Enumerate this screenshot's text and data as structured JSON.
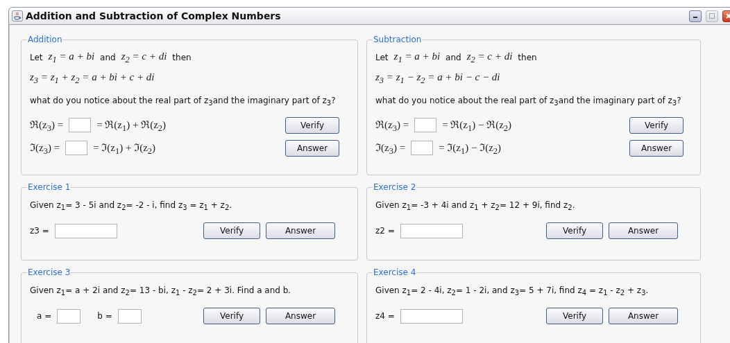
{
  "window": {
    "title": "Addition and Subtraction of Complex Numbers"
  },
  "concepts": [
    {
      "title": "Addition",
      "intro": [
        {
          "kind": "text",
          "text": "Let"
        },
        {
          "kind": "math",
          "text": "z$_{1}$ = a + bi"
        },
        {
          "kind": "text",
          "text": "and"
        },
        {
          "kind": "math",
          "text": "z$_{2}$ = c + di"
        },
        {
          "kind": "text",
          "text": "then"
        }
      ],
      "equation": "z$_{3}$ = z$_{1}$ + z$_{2}$ = a + bi + c + di",
      "question": "what do you notice about the real part of z$_{3}$and the imaginary part of z$_{3}$?",
      "rows": [
        {
          "lhs": "ℜ(z$_{3}$) =",
          "rhs": "= ℜ(z$_{1}$) + ℜ(z$_{2}$)",
          "button": "Verify"
        },
        {
          "lhs": "ℑ(z$_{3}$) =",
          "rhs": "= ℑ(z$_{1}$) + ℑ(z$_{2}$)",
          "button": "Answer"
        }
      ]
    },
    {
      "title": "Subtraction",
      "intro": [
        {
          "kind": "text",
          "text": "Let"
        },
        {
          "kind": "math",
          "text": "z$_{1}$ = a + bi"
        },
        {
          "kind": "text",
          "text": "and"
        },
        {
          "kind": "math",
          "text": "z$_{2}$ = c + di"
        },
        {
          "kind": "text",
          "text": "then"
        }
      ],
      "equation": "z$_{3}$ = z$_{1}$ − z$_{2}$ = a + bi − c − di",
      "question": "what do you notice about the real part of z$_{3}$and the imaginary part of z$_{3}$?",
      "rows": [
        {
          "lhs": "ℜ(z$_{3}$) =",
          "rhs": "= ℜ(z$_{1}$) − ℜ(z$_{2}$)",
          "button": "Verify"
        },
        {
          "lhs": "ℑ(z$_{3}$) =",
          "rhs": "= ℑ(z$_{1}$) − ℑ(z$_{2}$)",
          "button": "Answer"
        }
      ]
    }
  ],
  "exercises": [
    {
      "title": "Exercise 1",
      "prompt": "Given z$_{1}$= 3 - 5i and z$_{2}$= -2 - i, find z$_{3}$ = z$_{1}$ + z$_{2}$.",
      "fields": [
        {
          "label": "z3 =",
          "kind": "wide"
        }
      ],
      "buttons": [
        "Verify",
        "Answer"
      ]
    },
    {
      "title": "Exercise 2",
      "prompt": "Given z$_{1}$= -3 + 4i and z$_{1}$ + z$_{2}$= 12 + 9i, find z$_{2}$.",
      "fields": [
        {
          "label": "z2 =",
          "kind": "wide"
        }
      ],
      "buttons": [
        "Verify",
        "Answer"
      ]
    },
    {
      "title": "Exercise 3",
      "prompt": "Given z$_{1}$= a + 2i and z$_{2}$= 13 - bi, z$_{1}$ - z$_{2}$= 2 + 3i. Find a and b.",
      "fields": [
        {
          "label": "a =",
          "kind": "narrow"
        },
        {
          "label": "b =",
          "kind": "narrow"
        }
      ],
      "buttons": [
        "Verify",
        "Answer"
      ]
    },
    {
      "title": "Exercise 4",
      "prompt": "Given z$_{1}$= 2 - 4i, z$_{2}$= 1 - 2i, and z$_{3}$= 5 + 7i, find z$_{4}$ = z$_{1}$ - z$_{2}$ + z$_{3}$.",
      "fields": [
        {
          "label": "z4 =",
          "kind": "wide"
        }
      ],
      "buttons": [
        "Verify",
        "Answer"
      ]
    }
  ]
}
